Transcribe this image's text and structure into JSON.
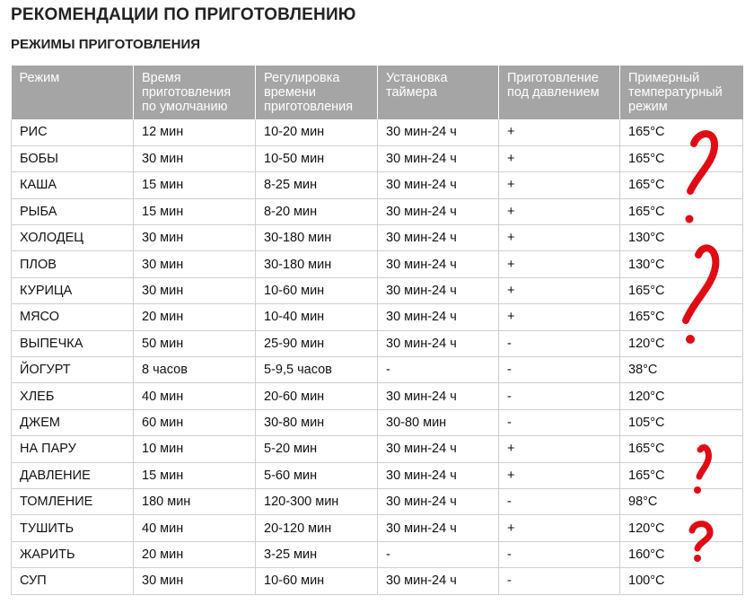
{
  "title": "РЕКОМЕНДАЦИИ ПО ПРИГОТОВЛЕНИЮ",
  "subtitle": "РЕЖИМЫ ПРИГОТОВЛЕНИЯ",
  "table": {
    "headers": [
      "Режим",
      "Время приготовления по умолчанию",
      "Регулировка времени приготовления",
      "Установка таймера",
      "Приготовление под давлением",
      "Примерный температурный режим"
    ],
    "rows": [
      [
        "РИС",
        "12 мин",
        "10-20 мин",
        "30 мин-24 ч",
        "+",
        "165°C"
      ],
      [
        "БОБЫ",
        "30 мин",
        "10-50 мин",
        "30 мин-24 ч",
        "+",
        "165°C"
      ],
      [
        "КАША",
        "15 мин",
        "8-25 мин",
        "30 мин-24 ч",
        "+",
        "165°C"
      ],
      [
        "РЫБА",
        "15 мин",
        "8-20 мин",
        "30 мин-24 ч",
        "+",
        "165°C"
      ],
      [
        "ХОЛОДЕЦ",
        "30 мин",
        "30-180 мин",
        "30 мин-24 ч",
        "+",
        "130°C"
      ],
      [
        "ПЛОВ",
        "30 мин",
        "30-180 мин",
        "30 мин-24 ч",
        "+",
        "130°C"
      ],
      [
        "КУРИЦА",
        "30 мин",
        "10-60 мин",
        "30 мин-24 ч",
        "+",
        "165°C"
      ],
      [
        "МЯСО",
        "20 мин",
        "10-40 мин",
        "30 мин-24 ч",
        "+",
        "165°C"
      ],
      [
        "ВЫПЕЧКА",
        "50 мин",
        "25-90 мин",
        "30 мин-24 ч",
        "-",
        "120°C"
      ],
      [
        "ЙОГУРТ",
        "8 часов",
        "5-9,5 часов",
        "-",
        "-",
        "38°C"
      ],
      [
        "ХЛЕБ",
        "40 мин",
        "20-60 мин",
        "30 мин-24 ч",
        "-",
        "120°C"
      ],
      [
        "ДЖЕМ",
        "60 мин",
        "30-80 мин",
        "30-80 мин",
        "-",
        "105°C"
      ],
      [
        "НА ПАРУ",
        "10 мин",
        "5-20 мин",
        "30 мин-24 ч",
        "+",
        "165°C"
      ],
      [
        "ДАВЛЕНИЕ",
        "15 мин",
        "5-60 мин",
        "30 мин-24 ч",
        "+",
        "165°C"
      ],
      [
        "ТОМЛЕНИЕ",
        "180 мин",
        "120-300 мин",
        "30 мин-24 ч",
        "-",
        "98°C"
      ],
      [
        "ТУШИТЬ",
        "40 мин",
        "20-120 мин",
        "30 мин-24 ч",
        "+",
        "120°C"
      ],
      [
        "ЖАРИТЬ",
        "20 мин",
        "3-25 мин",
        "-",
        "-",
        "160°C"
      ],
      [
        "СУП",
        "30 мин",
        "10-60 мин",
        "30 мин-24 ч",
        "-",
        "100°C"
      ]
    ]
  },
  "colors": {
    "header_bg": "#a5a5a5",
    "annotation_red": "#e10b14"
  },
  "annotations": [
    "question-mark",
    "question-mark",
    "question-mark",
    "question-mark"
  ]
}
